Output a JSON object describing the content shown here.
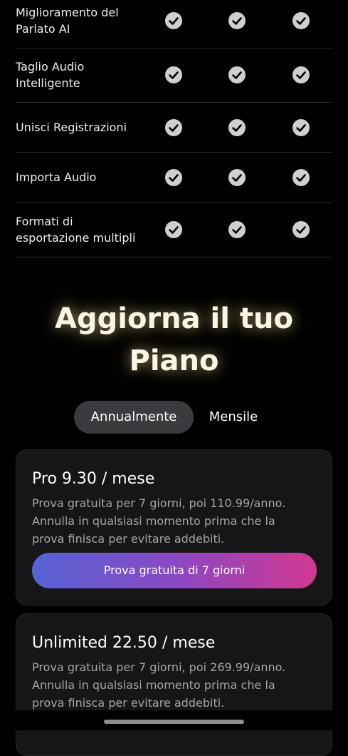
{
  "features": [
    {
      "label": "Miglioramento del Parlato AI",
      "line1": "Miglioramento del",
      "line2": "Parlato AI"
    },
    {
      "label": "Taglio Audio Intelligente",
      "line1": "Taglio Audio",
      "line2": "Intelligente"
    },
    {
      "label": "Unisci Registrazioni",
      "line1": "Unisci Registrazioni",
      "line2": ""
    },
    {
      "label": "Importa Audio",
      "line1": "Importa Audio",
      "line2": ""
    },
    {
      "label": "Formati di esportazione multipli",
      "line1": "Formati di",
      "line2": "esportazione multipli"
    }
  ],
  "check_icon": "check-circle-icon",
  "headline": {
    "line1": "Aggiorna il tuo",
    "line2": "Piano"
  },
  "billing_toggle": {
    "active": "Annualmente",
    "inactive": "Mensile"
  },
  "plans": [
    {
      "title": "Pro 9.30 / mese",
      "desc_line1": "Prova gratuita per 7 giorni, poi 110.99/anno.",
      "desc_line2": "Annulla in qualsiasi momento prima che la",
      "desc_line3": "prova finisca per evitare addebiti.",
      "cta": "Prova gratuita di 7 giorni"
    },
    {
      "title": "Unlimited 22.50 / mese",
      "desc_line1": "Prova gratuita per 7 giorni, poi 269.99/anno.",
      "desc_line2": "Annulla in qualsiasi momento prima che la",
      "desc_line3": "prova finisca per evitare addebiti."
    }
  ],
  "colors": {
    "background": "#000000",
    "card": "#161618",
    "check": "#cfcfd2",
    "gradient_start": "#5664d4",
    "gradient_end": "#d0398f",
    "headline": "#fbf5e4"
  }
}
